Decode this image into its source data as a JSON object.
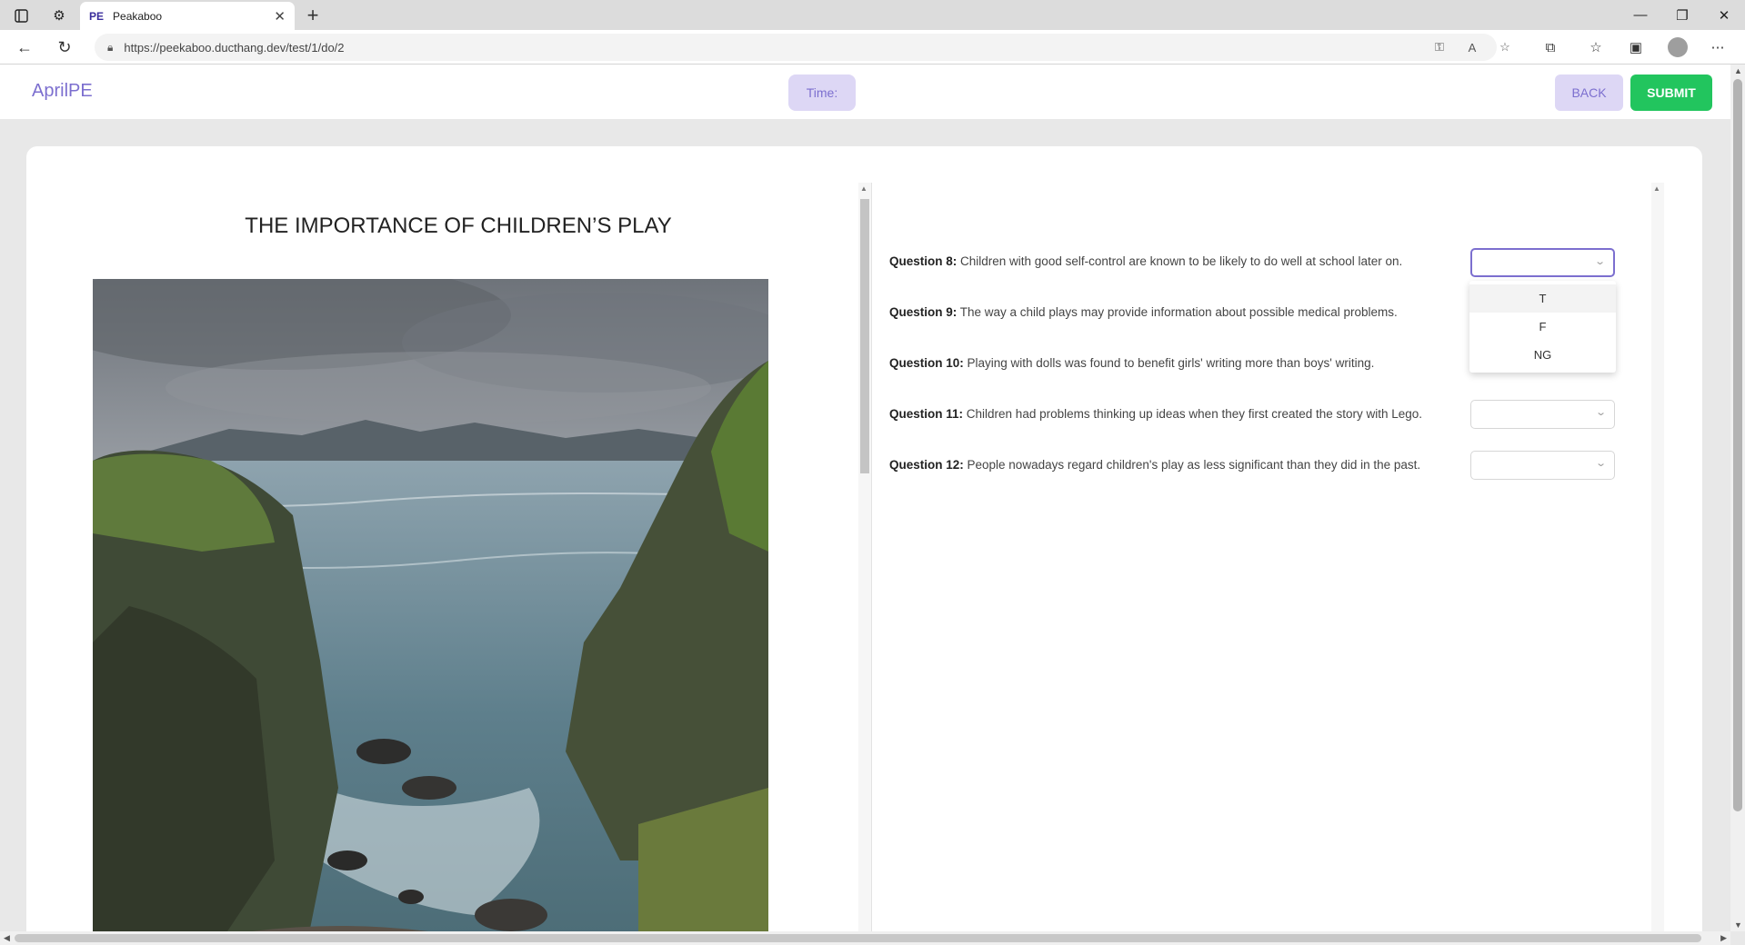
{
  "browser": {
    "tab_favicon": "PE",
    "tab_title": "Peakaboo",
    "url": "https://peekaboo.ducthang.dev/test/1/do/2"
  },
  "header": {
    "brand": "AprilPE",
    "time_label": "Time:",
    "back_label": "BACK",
    "submit_label": "SUBMIT"
  },
  "passage": {
    "title": "THE IMPORTANCE OF CHILDREN’S PLAY"
  },
  "questions": [
    {
      "label": "Question 8:",
      "text": " Children with good self-control are known to be likely to do well at school later on."
    },
    {
      "label": "Question 9:",
      "text": " The way a child plays may provide information about possible medical problems."
    },
    {
      "label": "Question 10:",
      "text": " Playing with dolls was found to benefit girls' writing more than boys' writing."
    },
    {
      "label": "Question 11:",
      "text": " Children had problems thinking up ideas when they first created the story with Lego."
    },
    {
      "label": "Question 12:",
      "text": " People nowadays regard children's play as less significant than they did in the past."
    }
  ],
  "dropdown_options": [
    "T",
    "F",
    "NG"
  ],
  "colors": {
    "accent": "#7c6fcf",
    "accent_bg": "#ddd7f5",
    "submit": "#22c55e"
  },
  "icons": [
    "tab-actions-icon",
    "settings-icon",
    "close-icon",
    "new-tab-icon",
    "back-arrow-icon",
    "refresh-icon",
    "lock-icon",
    "key-icon",
    "read-aloud-icon",
    "favorite-add-icon",
    "extensions-icon",
    "favorites-icon",
    "collections-icon",
    "profile-icon",
    "more-icon",
    "chevron-down-icon"
  ]
}
